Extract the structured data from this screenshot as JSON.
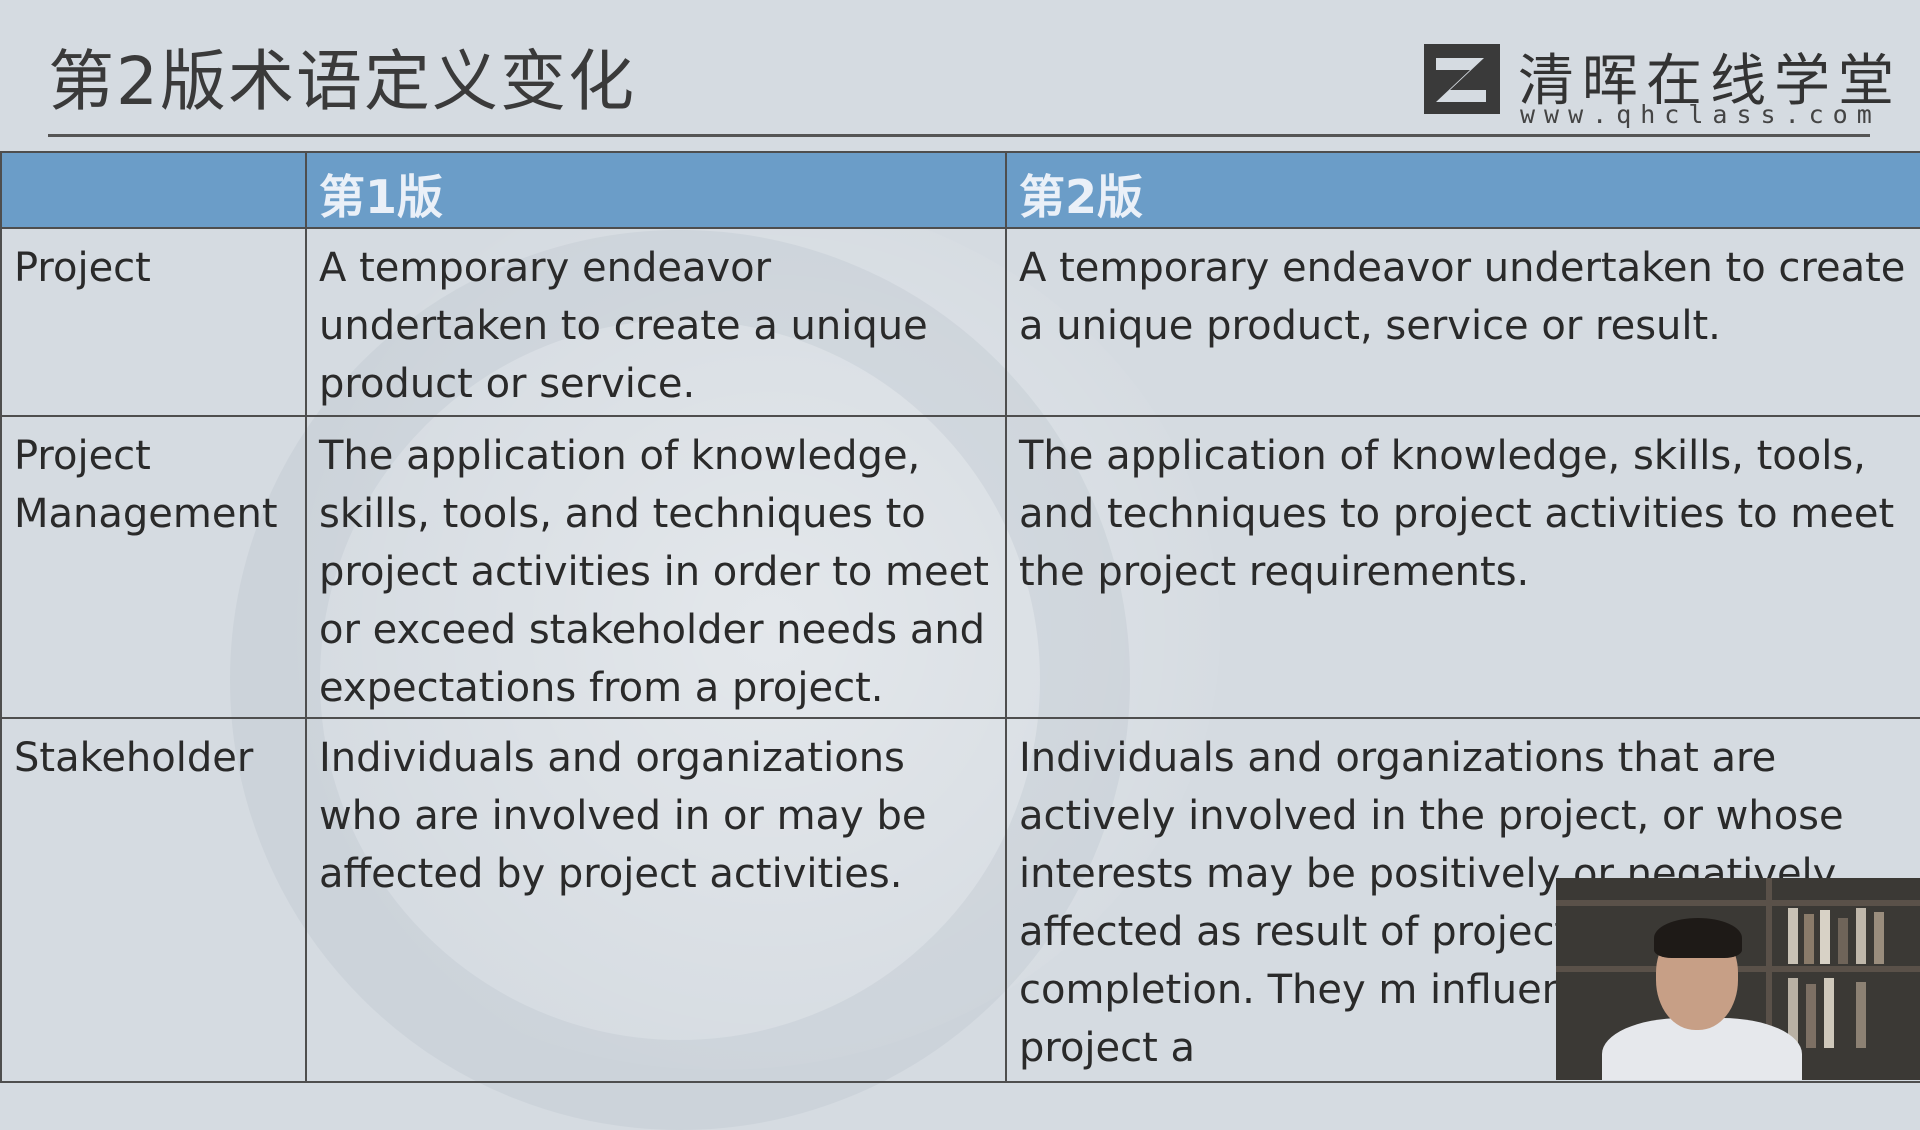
{
  "slide": {
    "title": "第2版术语定义变化"
  },
  "brand": {
    "name": "清晖在线学堂",
    "url": "www.qhclass.com",
    "logo_icon": "qh-logo-icon"
  },
  "table": {
    "headers": [
      "",
      "第1版",
      "第2版"
    ],
    "rows": [
      {
        "term": "Project",
        "v1": "A temporary endeavor undertaken to create a unique product or service.",
        "v2": "A temporary endeavor undertaken to create a unique product, service or result."
      },
      {
        "term": "Project Management",
        "v1": "The application of knowledge, skills, tools, and techniques to project activities in order to meet or exceed stakeholder needs and expectations from a project.",
        "v2": "The application of knowledge, skills, tools, and techniques to project activities to meet the  project requirements."
      },
      {
        "term": "Stakeholder",
        "v1": "Individuals and organizations who are involved in or may be affected by project activities.",
        "v2": "Individuals and organizations that are actively involved in the project, or whose interests may be positively or negatively affected as result of project project completion. They m influence over the project a"
      }
    ]
  },
  "colors": {
    "background": "#d5dbe1",
    "header_fill": "#6b9dc8",
    "border": "#4e4e4e",
    "text": "#2a2a2a"
  }
}
